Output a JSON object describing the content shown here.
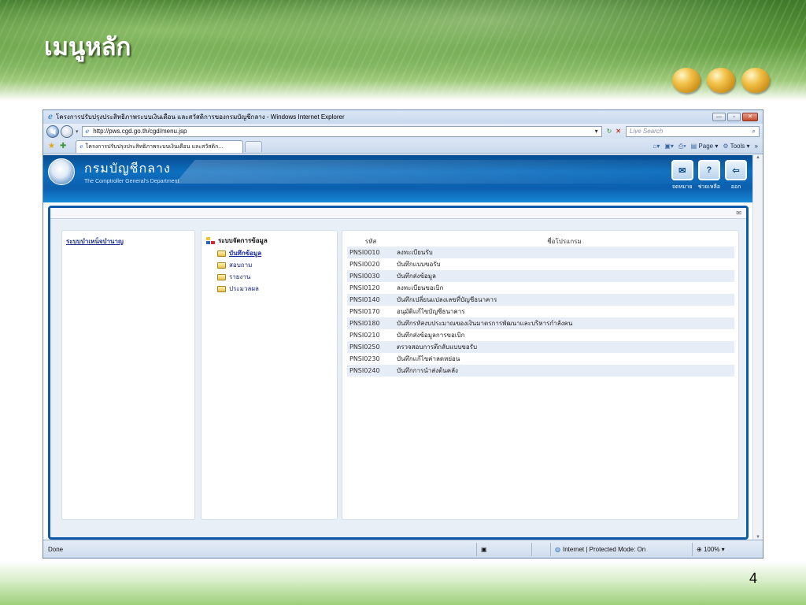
{
  "slide": {
    "title": "เมนูหลัก",
    "page_number": "4"
  },
  "browser": {
    "window_title": "โครงการปรับปรุงประสิทธิภาพระบบเงินเดือน และสวัสดิการของกรมบัญชีกลาง - Windows Internet Explorer",
    "url": "http://pws.cgd.go.th/cgd/menu.jsp",
    "search_placeholder": "Live Search",
    "tab_label": "โครงการปรับปรุงประสิทธิภาพระบบเงินเดือน และสวัสดิก...",
    "page_menu": "Page",
    "tools_menu": "Tools",
    "status_text": "Done",
    "zone_text": "Internet | Protected Mode: On",
    "zoom": "100%"
  },
  "site": {
    "title_th": "กรมบัญชีกลาง",
    "title_en": "The Comptroller General's Department",
    "icons": [
      {
        "label": "จดหมาย",
        "icon": "mail-icon"
      },
      {
        "label": "ช่วยเหลือ",
        "icon": "help-icon"
      },
      {
        "label": "ออก",
        "icon": "logout-icon"
      }
    ]
  },
  "left_menu": {
    "link": "ระบบบำเหน็จบำนาญ"
  },
  "tree": {
    "root": "ระบบจัดการข้อมูล",
    "items": [
      {
        "label": "บันทึกข้อมูล",
        "selected": true
      },
      {
        "label": "สอบถาม",
        "selected": false
      },
      {
        "label": "รายงาน",
        "selected": false
      },
      {
        "label": "ประมวลผล",
        "selected": false
      }
    ]
  },
  "programs": {
    "headers": {
      "code": "รหัส",
      "name": "ชื่อโปรแกรม"
    },
    "rows": [
      {
        "code": "PNSI0010",
        "name": "ลงทะเบียนรับ"
      },
      {
        "code": "PNSI0020",
        "name": "บันทึกแบบขอรับ"
      },
      {
        "code": "PNSI0030",
        "name": "บันทึกส่งข้อมูล"
      },
      {
        "code": "PNSI0120",
        "name": "ลงทะเบียนขอเบิก"
      },
      {
        "code": "PNSI0140",
        "name": "บันทึกเปลี่ยนแปลงเลขที่บัญชีธนาคาร"
      },
      {
        "code": "PNSI0170",
        "name": "อนุมัติแก้ไขบัญชีธนาคาร"
      },
      {
        "code": "PNSI0180",
        "name": "บันทึกรหัสงบประมาณของเงินมาตรการพัฒนาและบริหารกำลังคน"
      },
      {
        "code": "PNSI0210",
        "name": "บันทึกส่งข้อมูลการขอเบิก"
      },
      {
        "code": "PNSI0250",
        "name": "ตรวจสอบการตีกลับแบบขอรับ"
      },
      {
        "code": "PNSI0230",
        "name": "บันทึกแก้ไขค่าลดหย่อน"
      },
      {
        "code": "PNSI0240",
        "name": "บันทึกการนำส่งต้นคลัง"
      }
    ]
  }
}
